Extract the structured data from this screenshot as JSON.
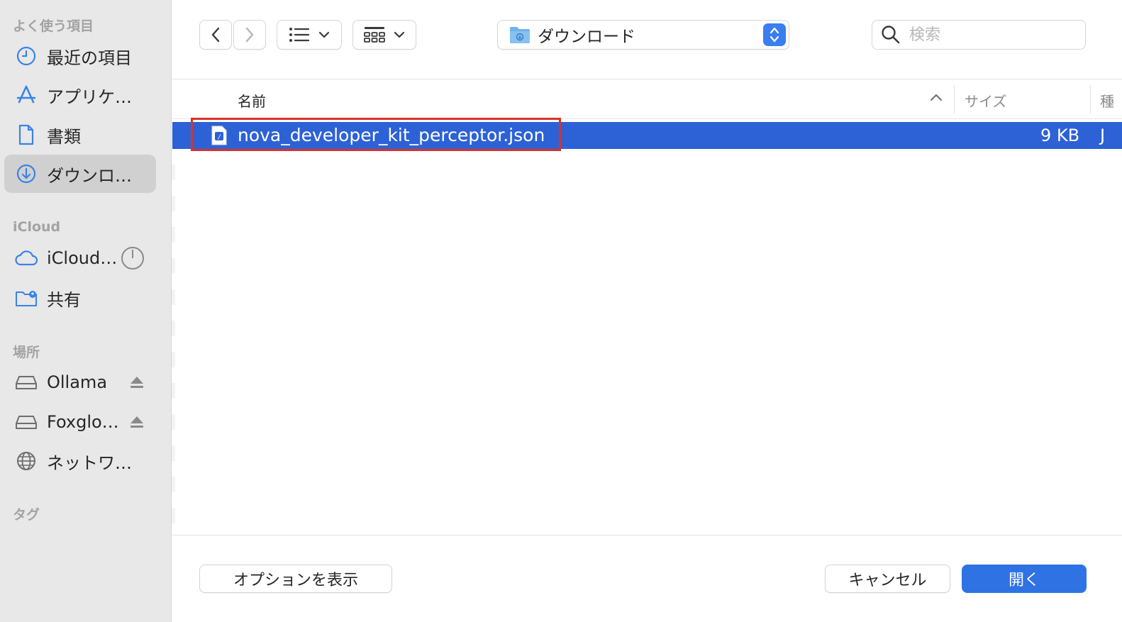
{
  "sidebar": {
    "favorites_header": "よく使う項目",
    "favorites": [
      {
        "label": "最近の項目",
        "icon": "clock-icon"
      },
      {
        "label": "アプリケ…",
        "icon": "applications-icon"
      },
      {
        "label": "書類",
        "icon": "document-icon"
      },
      {
        "label": "ダウンロ…",
        "icon": "download-icon",
        "selected": true
      }
    ],
    "icloud_header": "iCloud",
    "icloud": [
      {
        "label": "iCloud…",
        "icon": "cloud-icon"
      },
      {
        "label": "共有",
        "icon": "shared-folder-icon"
      }
    ],
    "locations_header": "場所",
    "locations": [
      {
        "label": "Ollama",
        "icon": "drive-icon"
      },
      {
        "label": "Foxglo…",
        "icon": "drive-icon"
      },
      {
        "label": "ネットワ…",
        "icon": "network-icon"
      }
    ],
    "tags_header": "タグ"
  },
  "toolbar": {
    "location": "ダウンロード",
    "search_placeholder": "検索"
  },
  "columns": {
    "name": "名前",
    "size": "サイズ",
    "kind": "種"
  },
  "files": [
    {
      "name": "nova_developer_kit_perceptor.json",
      "size": "9 KB",
      "kind": "J",
      "selected": true
    }
  ],
  "footer": {
    "options_label": "オプションを表示",
    "cancel_label": "キャンセル",
    "open_label": "開く"
  },
  "colors": {
    "accent": "#2d62d6",
    "primary_button": "#2f72e4",
    "highlight": "#d7332b",
    "sidebar_bg": "#e8e8e8"
  }
}
